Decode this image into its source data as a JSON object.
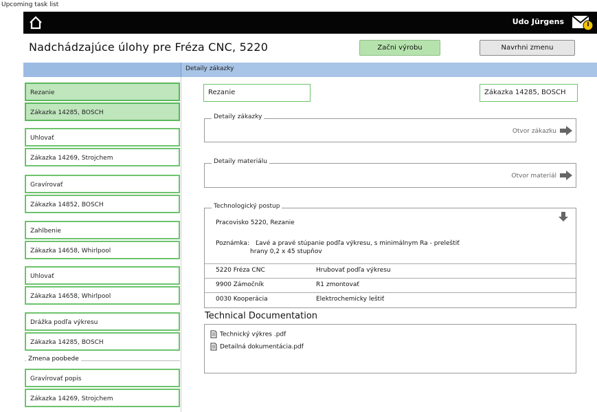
{
  "caption": "Upcoming task list",
  "topbar": {
    "user": "Udo Jürgens",
    "home_icon": "home-icon",
    "mail_icon": "mail-notification-icon"
  },
  "header": {
    "title": "Nadchádzajúce úlohy pre Fréza CNC, 5220",
    "start_button": "Začni výrobu",
    "propose_button": "Navrhni zmenu"
  },
  "section_bar": {
    "title": "Detaily zákazky"
  },
  "tasks": [
    {
      "operation": "Rezanie",
      "order": "Zákazka 14285, BOSCH",
      "selected": true
    },
    {
      "operation": "Uhlovať",
      "order": "Zákazka 14269, Strojchem",
      "selected": false
    },
    {
      "operation": "Gravírovať",
      "order": "Zákazka 14852, BOSCH",
      "selected": false
    },
    {
      "operation": "Zahlbenie",
      "order": "Zákazka 14658, Whirlpool",
      "selected": false
    },
    {
      "operation": "Uhlovať",
      "order": "Zákazka 14658, Whirlpool",
      "selected": false
    },
    {
      "operation": "Drážka podľa výkresu",
      "order": "Zákazka 14285, BOSCH",
      "selected": false
    }
  ],
  "shift_label": "Zmena poobede",
  "shift_tasks": [
    {
      "operation": "Gravírovať popis",
      "order": "Zákazka 14269, Strojchem"
    }
  ],
  "detail": {
    "operation_field": "Rezanie",
    "order_field": "Zákazka 14285, BOSCH",
    "order_details": {
      "legend": "Detaily zákazky",
      "link": "Otvor zákazku"
    },
    "material_details": {
      "legend": "Detaily materiálu",
      "link": "Otvor materiál"
    },
    "tech_process": {
      "legend": "Technologický postup",
      "workplace": "Pracovisko 5220, Rezanie",
      "note_label": "Poznámka:",
      "note_line1": "Ľavé a pravé stúpanie podľa výkresu, s minimálnym Ra - preleštiť",
      "note_line2": "hrany 0,2 x 45 stupňov",
      "steps": [
        {
          "station": "5220 Fréza CNC",
          "action": "Hrubovať podľa výkresu"
        },
        {
          "station": "9900 Zámočník",
          "action": "R1 zmontovať"
        },
        {
          "station": "0030 Kooperácia",
          "action": "Elektrochemicky leštiť"
        }
      ]
    }
  },
  "tech_documentation": {
    "title": "Technical Documentation",
    "files": [
      "Technický výkres .pdf",
      "Detailná dokumentácia.pdf"
    ]
  },
  "colors": {
    "accent_green": "#6cc36c",
    "selected_green": "#bfe6bd",
    "blue_bar": "#a8c4e6",
    "topbar": "#050505"
  }
}
